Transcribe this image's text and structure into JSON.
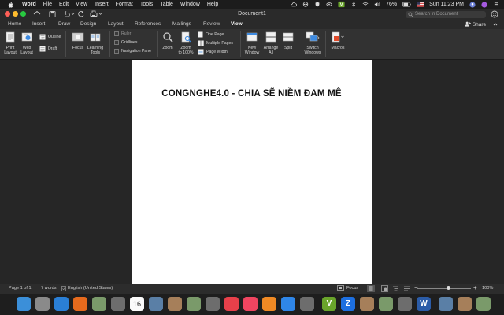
{
  "menubar": {
    "app": "Word",
    "items": [
      "File",
      "Edit",
      "View",
      "Insert",
      "Format",
      "Tools",
      "Table",
      "Window",
      "Help"
    ],
    "battery": "76%",
    "clock": "Sun 11:23 PM"
  },
  "window": {
    "title": "Document1",
    "search_placeholder": "Search in Document"
  },
  "tabs": [
    "Home",
    "Insert",
    "Draw",
    "Design",
    "Layout",
    "References",
    "Mailings",
    "Review",
    "View"
  ],
  "active_tab": "View",
  "share_label": "Share",
  "ribbon": {
    "print_layout": "Print\nLayout",
    "web_layout": "Web\nLayout",
    "outline": "Outline",
    "draft": "Draft",
    "focus": "Focus",
    "learning_tools": "Learning\nTools",
    "ruler": "Ruler",
    "gridlines": "Gridlines",
    "navigation_pane": "Navigation Pane",
    "zoom": "Zoom",
    "zoom_100": "Zoom\nto 100%",
    "one_page": "One Page",
    "multiple_pages": "Multiple Pages",
    "page_width": "Page Width",
    "new_window": "New\nWindow",
    "arrange_all": "Arrange\nAll",
    "split": "Split",
    "switch_windows": "Switch\nWindows",
    "macros": "Macros"
  },
  "document": {
    "heading": "CONGNGHE4.0 - CHIA SẼ NIỀM ĐAM MÊ"
  },
  "status": {
    "page": "Page 1 of 1",
    "words": "7 words",
    "language": "English (United States)",
    "focus": "Focus",
    "zoom": "100%",
    "zoom_level": 100
  },
  "dock": {
    "calendar_day": "16",
    "apps": [
      "finder",
      "launchpad",
      "safari",
      "firefox",
      "contacts-book",
      "photos-preview",
      "calendar",
      "notes",
      "reminders",
      "photos",
      "facetime",
      "news",
      "music",
      "books",
      "app-store",
      "system-preferences",
      "vivaldi",
      "zalo",
      "paint",
      "pages",
      "preview",
      "word",
      "downloads",
      "browser",
      "trash"
    ],
    "colors": {
      "finder": "#3b8fd9",
      "safari": "#2a7fd6",
      "firefox": "#e66a1d",
      "news": "#e8404a",
      "music": "#f04560",
      "books": "#f08a24",
      "app-store": "#2f86e8",
      "vivaldi": "#6aa52b",
      "zalo": "#1d6fe0",
      "word": "#2b5ca8"
    }
  },
  "colors": {
    "accent": "#2f8ce6",
    "ribbon_bg": "#323232",
    "page_bg": "#ffffff"
  }
}
